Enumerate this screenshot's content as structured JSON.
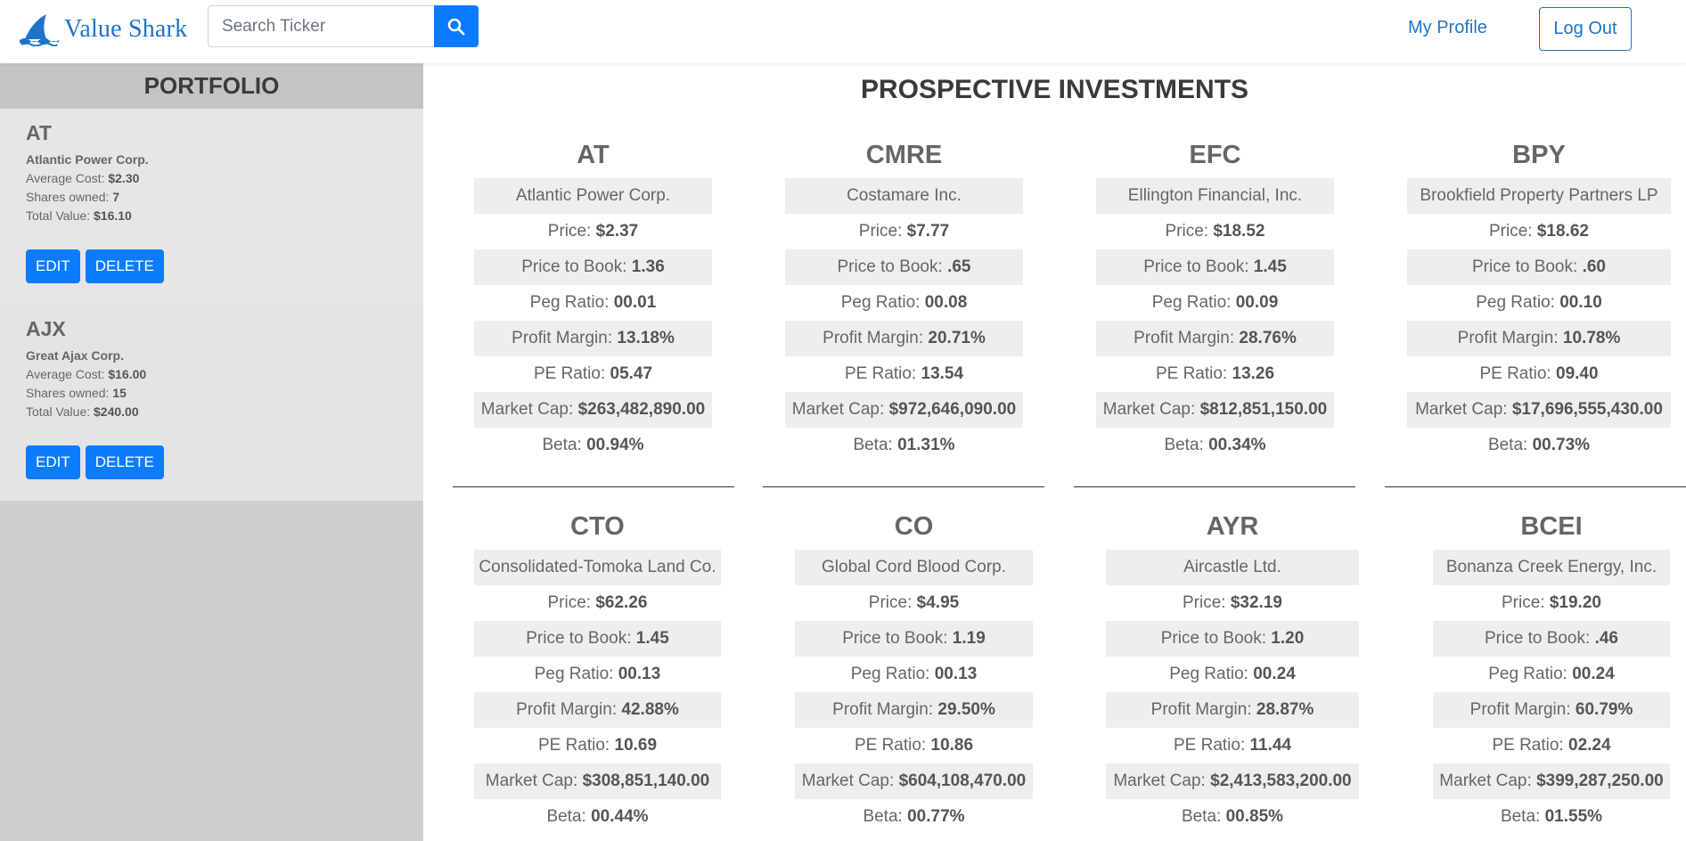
{
  "brand": {
    "name": "Value Shark"
  },
  "search": {
    "placeholder": "Search Ticker"
  },
  "nav": {
    "profile": "My Profile",
    "logout": "Log Out"
  },
  "sidebar": {
    "title": "PORTFOLIO",
    "holdings": [
      {
        "ticker": "AT",
        "name": "Atlantic Power Corp.",
        "avg_label": "Average Cost: ",
        "avg": "$2.30",
        "shares_label": "Shares owned: ",
        "shares": "7",
        "total_label": "Total Value: ",
        "total": "$16.10",
        "edit": "EDIT",
        "delete": "DELETE"
      },
      {
        "ticker": "AJX",
        "name": "Great Ajax Corp.",
        "avg_label": "Average Cost: ",
        "avg": "$16.00",
        "shares_label": "Shares owned: ",
        "shares": "15",
        "total_label": "Total Value: ",
        "total": "$240.00",
        "edit": "EDIT",
        "delete": "DELETE"
      }
    ]
  },
  "main": {
    "title": "PROSPECTIVE INVESTMENTS",
    "labels": {
      "price": "Price: ",
      "ptb": "Price to Book: ",
      "peg": "Peg Ratio: ",
      "pm": "Profit Margin: ",
      "pe": "PE Ratio: ",
      "mc": "Market Cap: ",
      "beta": "Beta: "
    },
    "cards": [
      {
        "ticker": "AT",
        "name": "Atlantic Power Corp.",
        "price": "$2.37",
        "ptb": "1.36",
        "peg": "00.01",
        "pm": "13.18%",
        "pe": "05.47",
        "mc": "$263,482,890.00",
        "beta": "00.94%"
      },
      {
        "ticker": "CMRE",
        "name": "Costamare Inc.",
        "price": "$7.77",
        "ptb": ".65",
        "peg": "00.08",
        "pm": "20.71%",
        "pe": "13.54",
        "mc": "$972,646,090.00",
        "beta": "01.31%"
      },
      {
        "ticker": "EFC",
        "name": "Ellington Financial, Inc.",
        "price": "$18.52",
        "ptb": "1.45",
        "peg": "00.09",
        "pm": "28.76%",
        "pe": "13.26",
        "mc": "$812,851,150.00",
        "beta": "00.34%"
      },
      {
        "ticker": "BPY",
        "name": "Brookfield Property Partners LP",
        "price": "$18.62",
        "ptb": ".60",
        "peg": "00.10",
        "pm": "10.78%",
        "pe": "09.40",
        "mc": "$17,696,555,430.00",
        "beta": "00.73%"
      },
      {
        "ticker": "CTO",
        "name": "Consolidated-Tomoka Land Co.",
        "price": "$62.26",
        "ptb": "1.45",
        "peg": "00.13",
        "pm": "42.88%",
        "pe": "10.69",
        "mc": "$308,851,140.00",
        "beta": "00.44%"
      },
      {
        "ticker": "CO",
        "name": "Global Cord Blood Corp.",
        "price": "$4.95",
        "ptb": "1.19",
        "peg": "00.13",
        "pm": "29.50%",
        "pe": "10.86",
        "mc": "$604,108,470.00",
        "beta": "00.77%"
      },
      {
        "ticker": "AYR",
        "name": "Aircastle Ltd.",
        "price": "$32.19",
        "ptb": "1.20",
        "peg": "00.24",
        "pm": "28.87%",
        "pe": "11.44",
        "mc": "$2,413,583,200.00",
        "beta": "00.85%"
      },
      {
        "ticker": "BCEI",
        "name": "Bonanza Creek Energy, Inc.",
        "price": "$19.20",
        "ptb": ".46",
        "peg": "00.24",
        "pm": "60.79%",
        "pe": "02.24",
        "mc": "$399,287,250.00",
        "beta": "01.55%"
      }
    ]
  }
}
